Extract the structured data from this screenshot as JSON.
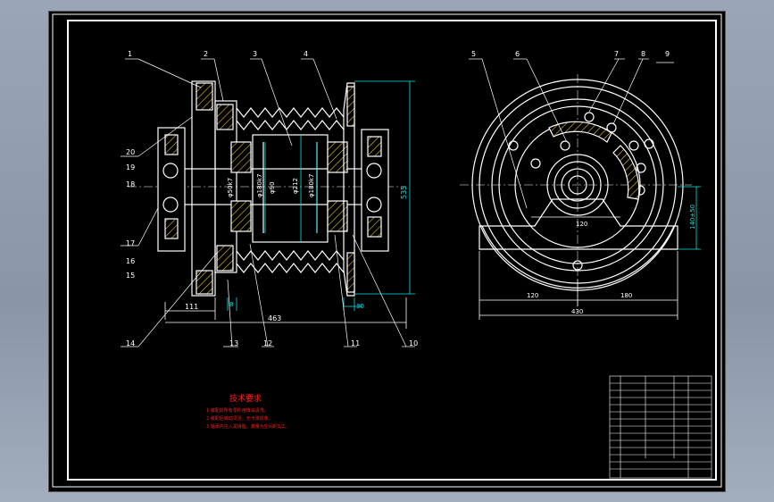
{
  "drawing": {
    "balloons": [
      "1",
      "2",
      "3",
      "4",
      "5",
      "6",
      "7",
      "8",
      "9",
      "10",
      "11",
      "12",
      "13",
      "14",
      "15",
      "16",
      "17",
      "18",
      "19",
      "20"
    ],
    "dimensions": {
      "bottom_left": "111",
      "bottom_total": "463",
      "height_right": "535",
      "small_8": "8",
      "small_30": "30",
      "d1": "φ50k7",
      "d2": "φ180k7",
      "d3": "φ90",
      "d4": "φ212",
      "d5": "φ180k7",
      "side_left": "120",
      "side_right": "180",
      "side_total": "430",
      "side_height": "140±50",
      "angle": "120"
    },
    "notes": {
      "heading": "技术要求",
      "lines": [
        "1.装配前所有零件用煤油清洗。",
        "2.装配后转动灵活，无卡滞现象。",
        "3.轴承内注入润滑脂，其量为空间的1/2。"
      ]
    }
  },
  "colors": {
    "line": "#ffffff",
    "dim": "#00e5e5",
    "hatch": "#e8c33a",
    "note": "#ff2020",
    "center": "#aaaaaa"
  }
}
